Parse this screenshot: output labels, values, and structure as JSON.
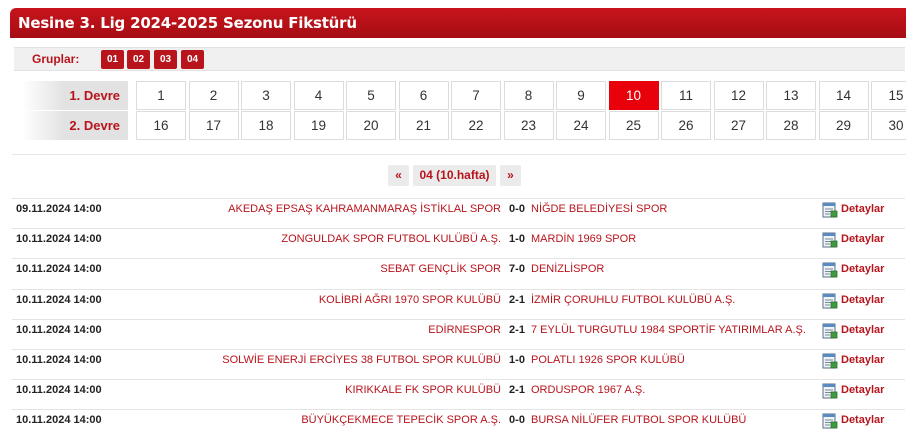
{
  "title": "Nesine 3. Lig 2024-2025 Sezonu Fikstürü",
  "groups": {
    "label": "Gruplar:",
    "items": [
      "01",
      "02",
      "03",
      "04"
    ]
  },
  "devre1": {
    "label": "1. Devre",
    "weeks": [
      "1",
      "2",
      "3",
      "4",
      "5",
      "6",
      "7",
      "8",
      "9",
      "10",
      "11",
      "12",
      "13",
      "14",
      "15"
    ]
  },
  "devre2": {
    "label": "2. Devre",
    "weeks": [
      "16",
      "17",
      "18",
      "19",
      "20",
      "21",
      "22",
      "23",
      "24",
      "25",
      "26",
      "27",
      "28",
      "29",
      "30"
    ]
  },
  "active_week": "10",
  "pager": {
    "prev": "«",
    "current": "04 (10.hafta)",
    "next": "»"
  },
  "detail_label": "Detaylar",
  "matches": [
    {
      "date": "09.11.2024 14:00",
      "home": "AKEDAŞ EPSAŞ KAHRAMANMARAŞ İSTİKLAL SPOR",
      "score": "0-0",
      "away": "NİĞDE BELEDİYESİ SPOR"
    },
    {
      "date": "10.11.2024 14:00",
      "home": "ZONGULDAK SPOR FUTBOL KULÜBÜ A.Ş.",
      "score": "1-0",
      "away": "MARDİN 1969 SPOR"
    },
    {
      "date": "10.11.2024 14:00",
      "home": "SEBAT GENÇLİK SPOR",
      "score": "7-0",
      "away": "DENİZLİSPOR"
    },
    {
      "date": "10.11.2024 14:00",
      "home": "KOLİBRİ AĞRI 1970 SPOR KULÜBÜ",
      "score": "2-1",
      "away": "İZMİR ÇORUHLU FUTBOL KULÜBÜ A.Ş."
    },
    {
      "date": "10.11.2024 14:00",
      "home": "EDİRNESPOR",
      "score": "2-1",
      "away": "7 EYLÜL TURGUTLU 1984 SPORTİF YATIRIMLAR A.Ş."
    },
    {
      "date": "10.11.2024 14:00",
      "home": "SOLWİE ENERJİ ERCİYES 38 FUTBOL SPOR KULÜBÜ",
      "score": "1-0",
      "away": "POLATLI 1926 SPOR KULÜBÜ"
    },
    {
      "date": "10.11.2024 14:00",
      "home": "KIRIKKALE FK SPOR KULÜBÜ",
      "score": "2-1",
      "away": "ORDUSPOR 1967 A.Ş."
    },
    {
      "date": "10.11.2024 14:00",
      "home": "BÜYÜKÇEKMECE TEPECİK SPOR A.Ş.",
      "score": "0-0",
      "away": "BURSA NİLÜFER FUTBOL SPOR KULÜBÜ"
    }
  ],
  "colors": {
    "brand_red": "#b8141c",
    "active_week_red": "#e8000b"
  }
}
